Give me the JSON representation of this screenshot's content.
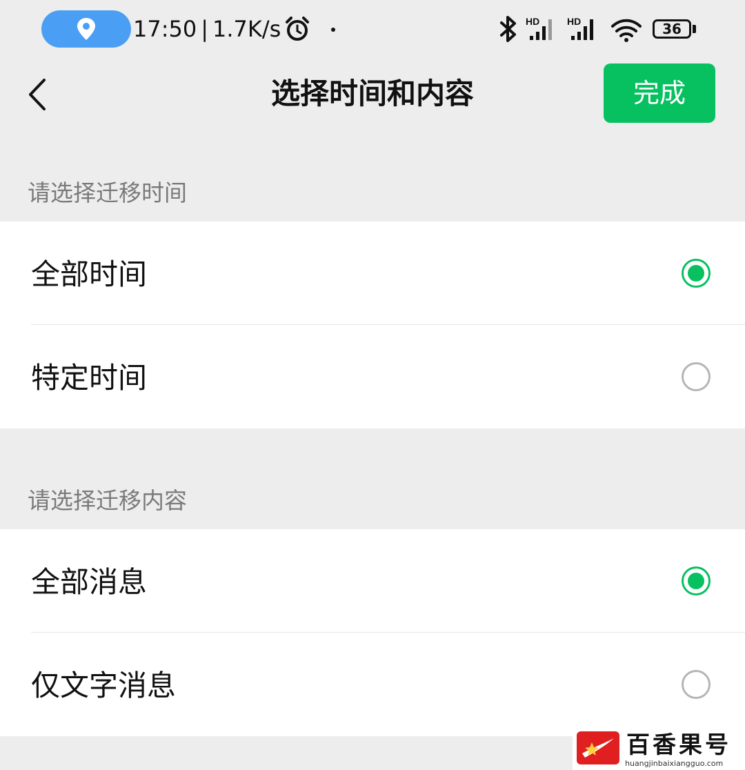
{
  "status_bar": {
    "time": "17:50",
    "separator": "|",
    "network_speed": "1.7K/s",
    "signal_label_1": "HD",
    "signal_label_2": "HD",
    "battery_level": "36",
    "icons": [
      "location-icon",
      "alarm-icon",
      "bluetooth-icon",
      "signal-icon",
      "wifi-icon",
      "battery-icon"
    ]
  },
  "nav": {
    "title": "选择时间和内容",
    "done_label": "完成",
    "back_icon": "chevron-left-icon"
  },
  "time_section": {
    "header": "请选择迁移时间",
    "options": [
      {
        "label": "全部时间",
        "selected": true
      },
      {
        "label": "特定时间",
        "selected": false
      }
    ]
  },
  "content_section": {
    "header": "请选择迁移内容",
    "options": [
      {
        "label": "全部消息",
        "selected": true
      },
      {
        "label": "仅文字消息",
        "selected": false
      }
    ]
  },
  "watermark": {
    "name": "百香果号",
    "url": "huangjinbaixiangguo.com"
  },
  "colors": {
    "accent": "#07c160",
    "background": "#ededed",
    "status_pill": "#4a9ff5",
    "radio_unchecked": "#b5b5b5",
    "watermark_logo": "#e02020"
  }
}
